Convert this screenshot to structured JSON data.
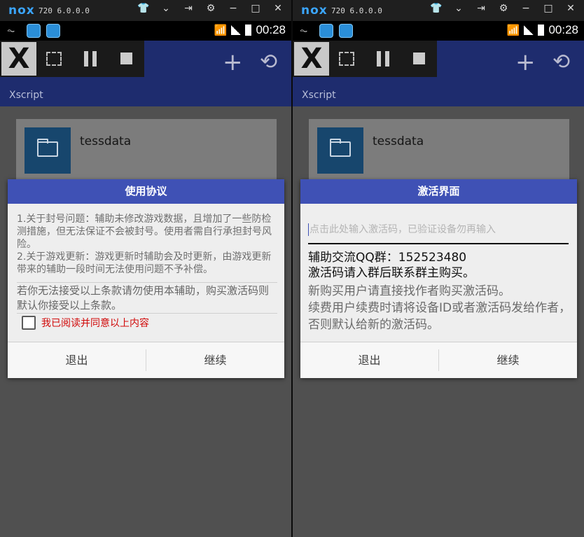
{
  "emulator": {
    "logo": "nox",
    "version": "720 6.0.0.0",
    "icons": [
      "shirt-icon",
      "chevron-down-icon",
      "pin-icon",
      "gear-icon",
      "minimize-icon",
      "maximize-icon",
      "close-icon"
    ]
  },
  "status_bar": {
    "time": "00:28"
  },
  "app": {
    "title": "Xscript"
  },
  "card": {
    "name": "tessdata"
  },
  "dialog_left": {
    "title": "使用协议",
    "para1": "1.关于封号问题：辅助未修改游戏数据，且增加了一些防检测措施，但无法保证不会被封号。使用者需自行承担封号风险。",
    "para2": "2.关于游戏更新：游戏更新时辅助会及时更新，由游戏更新带来的辅助一段时间无法使用问题不予补偿。",
    "warning": "若你无法接受以上条款请勿使用本辅助，购买激活码则默认你接受以上条款。",
    "checkbox_label": "我已阅读并同意以上内容",
    "exit_label": "退出",
    "continue_label": "继续"
  },
  "dialog_right": {
    "title": "激活界面",
    "input_placeholder": "点击此处输入激活码，已验证设备勿再输入",
    "qq_line1": "辅助交流QQ群：152523480",
    "qq_line2": "激活码请入群后联系群主购买。",
    "info1": "新购买用户请直接找作者购买激活码。",
    "info2": "续费用户续费时请将设备ID或者激活码发给作者，否则默认给新的激活码。",
    "exit_label": "退出",
    "continue_label": "继续"
  },
  "colors": {
    "dialog_header": "#3f51b5",
    "app_bar": "#1e2c6e",
    "checkbox_label": "#d10a0a",
    "nox_logo": "#3ba6ff"
  }
}
